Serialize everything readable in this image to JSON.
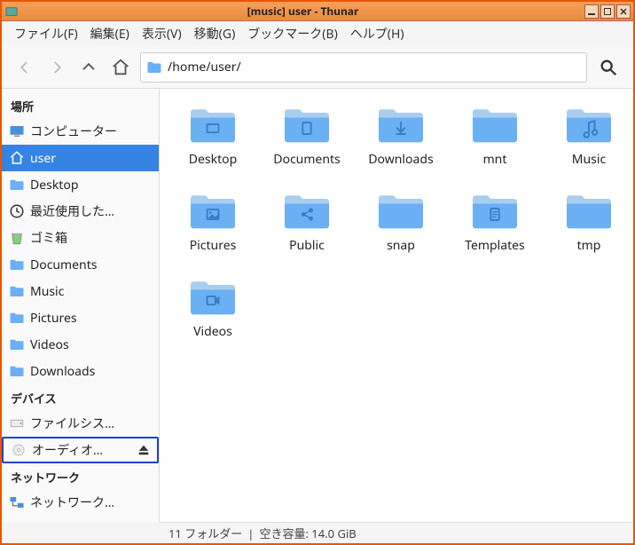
{
  "titlebar": {
    "text": "[music] user - Thunar"
  },
  "menu": {
    "file": "ファイル(F)",
    "edit": "編集(E)",
    "view": "表示(V)",
    "go": "移動(G)",
    "bookmarks": "ブックマーク(B)",
    "help": "ヘルプ(H)"
  },
  "path": "/home/user/",
  "sidebar": {
    "places_header": "場所",
    "places": [
      {
        "label": "コンピューター",
        "icon": "monitor"
      },
      {
        "label": "user",
        "icon": "home",
        "selected": true
      },
      {
        "label": "Desktop",
        "icon": "folder"
      },
      {
        "label": "最近使用した…",
        "icon": "clock"
      },
      {
        "label": "ゴミ箱",
        "icon": "trash"
      },
      {
        "label": "Documents",
        "icon": "folder"
      },
      {
        "label": "Music",
        "icon": "folder"
      },
      {
        "label": "Pictures",
        "icon": "folder"
      },
      {
        "label": "Videos",
        "icon": "folder"
      },
      {
        "label": "Downloads",
        "icon": "folder"
      }
    ],
    "devices_header": "デバイス",
    "devices": [
      {
        "label": "ファイルシス…",
        "icon": "drive"
      },
      {
        "label": "オーディオ…",
        "icon": "disc",
        "eject": true,
        "highlighted": true
      }
    ],
    "network_header": "ネットワーク",
    "network": [
      {
        "label": "ネットワーク…",
        "icon": "network"
      }
    ]
  },
  "files": [
    {
      "name": "Desktop",
      "glyph": "desktop"
    },
    {
      "name": "Documents",
      "glyph": "doc"
    },
    {
      "name": "Downloads",
      "glyph": "download"
    },
    {
      "name": "mnt",
      "glyph": "plain"
    },
    {
      "name": "Music",
      "glyph": "music"
    },
    {
      "name": "Pictures",
      "glyph": "picture"
    },
    {
      "name": "Public",
      "glyph": "share"
    },
    {
      "name": "snap",
      "glyph": "plain"
    },
    {
      "name": "Templates",
      "glyph": "template"
    },
    {
      "name": "tmp",
      "glyph": "plain"
    },
    {
      "name": "Videos",
      "glyph": "video"
    }
  ],
  "status": {
    "folders": "11 フォルダー",
    "sep": "|",
    "free": "空き容量: 14.0 GiB"
  }
}
